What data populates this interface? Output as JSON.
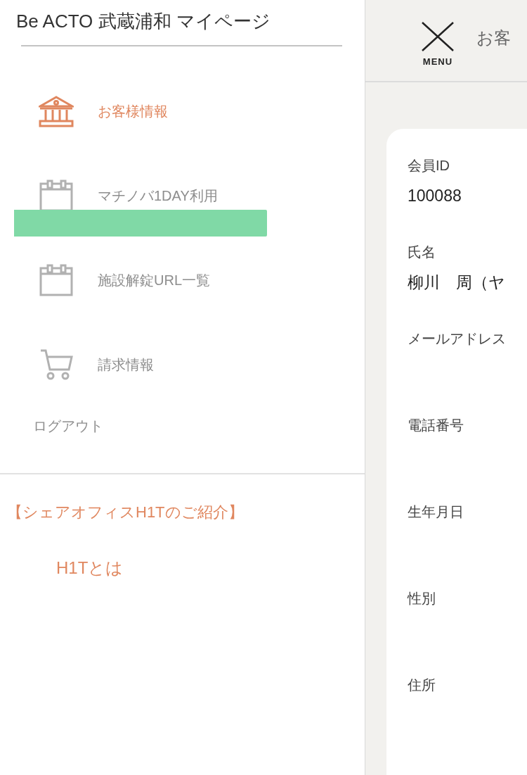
{
  "drawer": {
    "title": "Be ACTO 武蔵浦和 マイページ",
    "items": [
      {
        "kind": "bank",
        "label": "お客様情報",
        "selected": true
      },
      {
        "kind": "calendar",
        "label": "マチノバ1DAY利用",
        "selected": false
      },
      {
        "kind": "calendar",
        "label": "施設解錠URL一覧",
        "selected": false
      },
      {
        "kind": "cart",
        "label": "請求情報",
        "selected": false
      }
    ],
    "logout": "ログアウト",
    "section_heading": "【シェアオフィスH1Tのご紹介】",
    "links": [
      "H1Tとは"
    ]
  },
  "header": {
    "menu_label": "MENU",
    "title": "お客"
  },
  "profile": {
    "fields": [
      {
        "label": "会員ID",
        "value": "100088"
      },
      {
        "label": "氏名",
        "value": "柳川　周（ヤ"
      },
      {
        "label": "メールアドレス"
      },
      {
        "label": "電話番号"
      },
      {
        "label": "生年月日"
      },
      {
        "label": "性別"
      },
      {
        "label": "住所"
      }
    ]
  }
}
